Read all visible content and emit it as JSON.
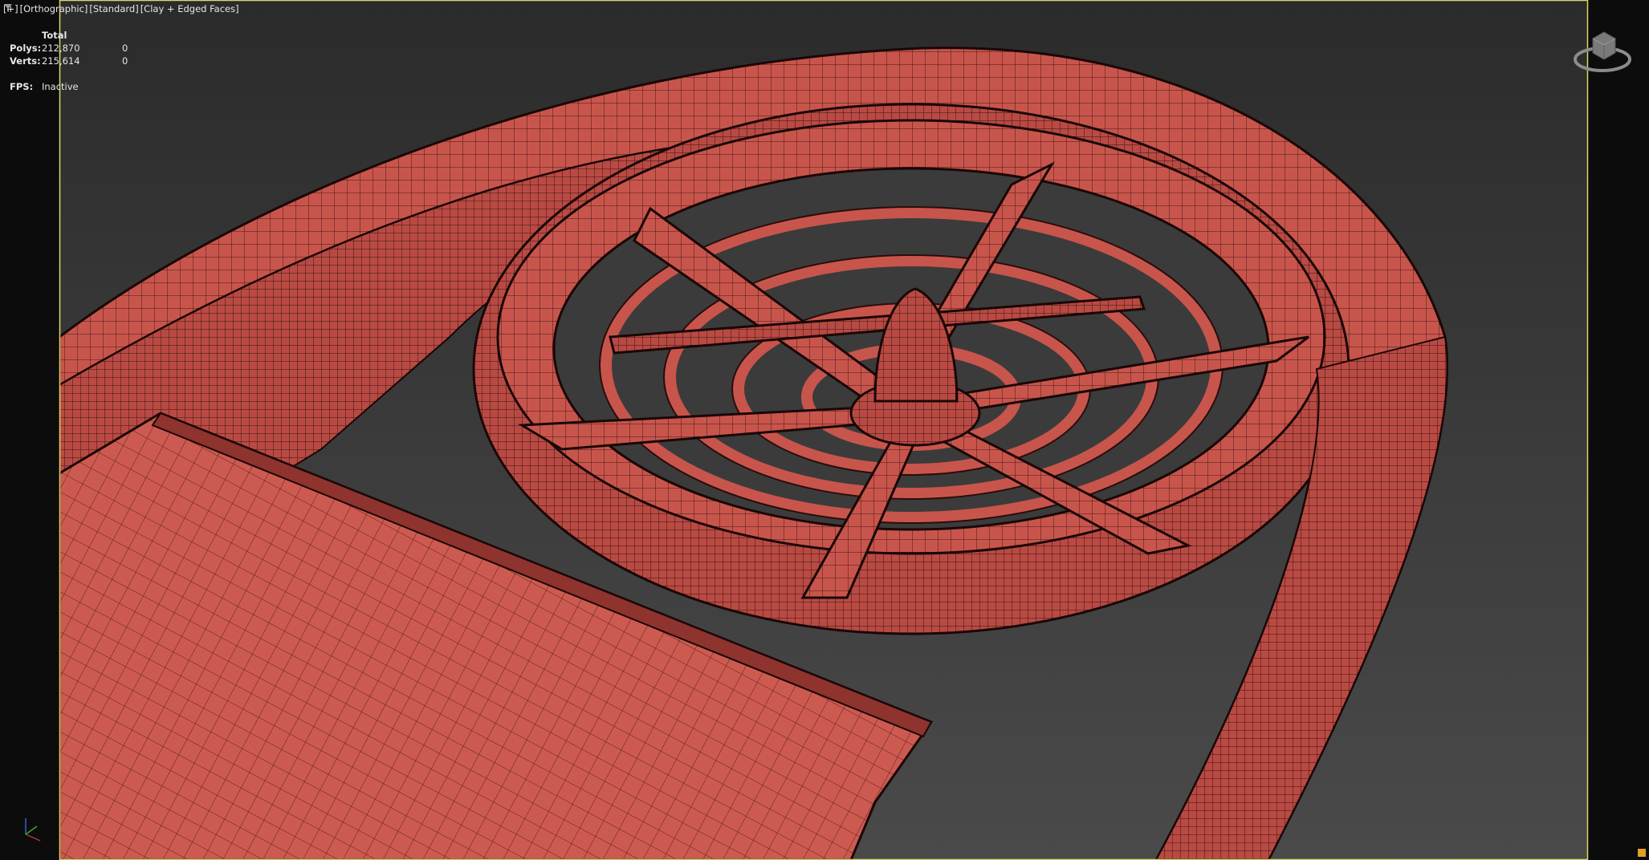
{
  "viewport": {
    "label_parts": [
      "[+]",
      "[Orthographic]",
      "[Standard]",
      "[Clay + Edged Faces]"
    ],
    "filter_icon": "filter-icon"
  },
  "stats": {
    "header": "Total",
    "rows": [
      {
        "label": "Polys:",
        "total": "212,870",
        "selected": "0"
      },
      {
        "label": "Verts:",
        "total": "215,614",
        "selected": "0"
      }
    ],
    "fps_label": "FPS:",
    "fps_value": "Inactive"
  },
  "colors": {
    "background_top": "#2b2b2b",
    "background_bottom": "#4a4a4a",
    "clay": "#c8554c",
    "wire": "#2a0d0b",
    "active_border": "#d8d86a"
  },
  "icons": {
    "viewcube": "viewcube-icon",
    "axis": "axis-tripod-icon",
    "corner": "maximize-toggle-icon"
  }
}
